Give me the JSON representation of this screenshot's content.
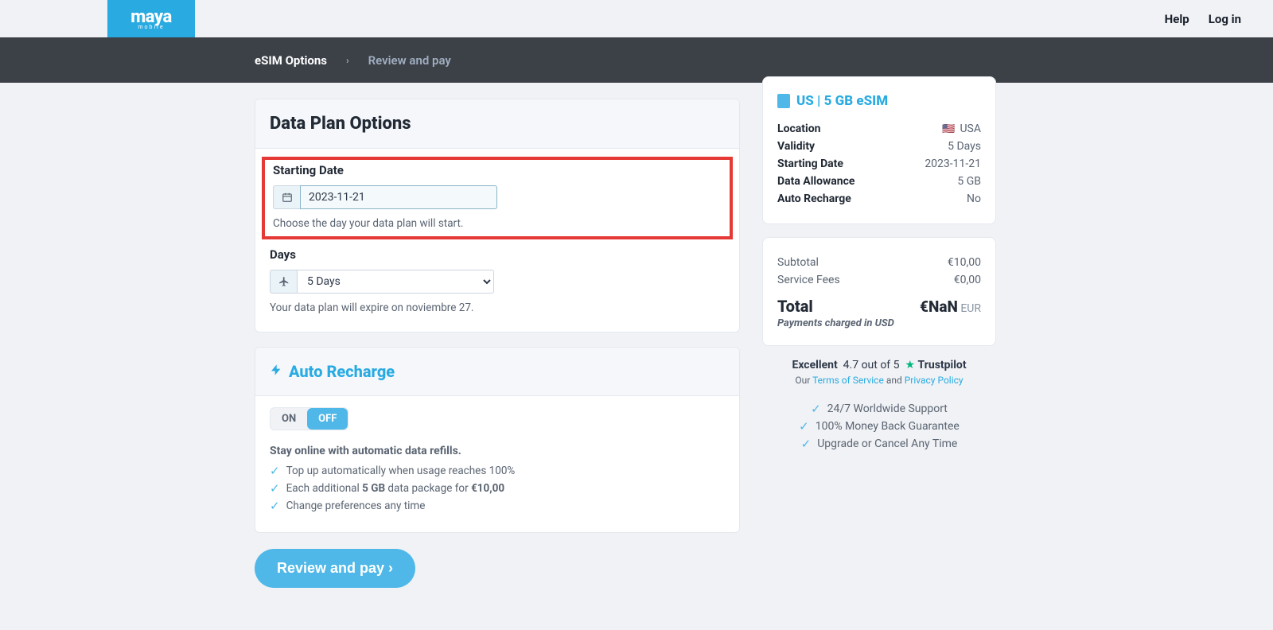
{
  "header": {
    "logo": "maya",
    "logo_sub": "mobile",
    "help": "Help",
    "login": "Log in"
  },
  "breadcrumb": {
    "step1": "eSIM Options",
    "step2": "Review and pay"
  },
  "plan_card": {
    "title": "Data Plan Options",
    "starting_date_label": "Starting Date",
    "starting_date_value": "2023-11-21",
    "starting_date_help": "Choose the day your data plan will start.",
    "days_label": "Days",
    "days_value": "5 Days",
    "days_help": "Your data plan will expire on noviembre 27."
  },
  "auto_recharge": {
    "title": "Auto Recharge",
    "on": "ON",
    "off": "OFF",
    "subtitle": "Stay online with automatic data refills.",
    "items": [
      "Top up automatically when usage reaches 100%",
      "Each additional 5 GB data package for €10,00",
      "Change preferences any time"
    ]
  },
  "cta_label": "Review and pay ›",
  "summary": {
    "title": "US | 5 GB eSIM",
    "rows": [
      {
        "k": "Location",
        "v": "USA"
      },
      {
        "k": "Validity",
        "v": "5 Days"
      },
      {
        "k": "Starting Date",
        "v": "2023-11-21"
      },
      {
        "k": "Data Allowance",
        "v": "5 GB"
      },
      {
        "k": "Auto Recharge",
        "v": "No"
      }
    ]
  },
  "pricing": {
    "subtotal_k": "Subtotal",
    "subtotal_v": "€10,00",
    "fees_k": "Service Fees",
    "fees_v": "€0,00",
    "total_k": "Total",
    "total_v": "€NaN",
    "total_cur": "EUR",
    "note": "Payments charged in USD"
  },
  "trust": {
    "excellent": "Excellent",
    "rating": "4.7 out of 5",
    "tp": "Trustpilot",
    "our": "Our",
    "tos": "Terms of Service",
    "and": "and",
    "pp": "Privacy Policy"
  },
  "features": [
    "24/7 Worldwide Support",
    "100% Money Back Guarantee",
    "Upgrade or Cancel Any Time"
  ]
}
